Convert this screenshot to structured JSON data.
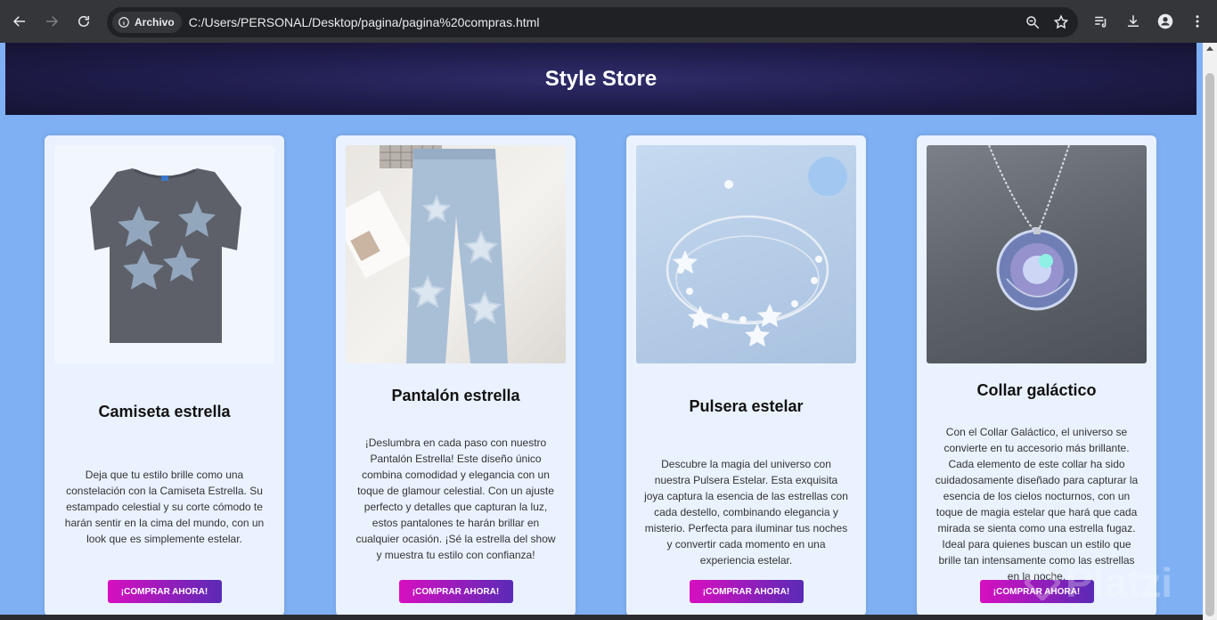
{
  "browser": {
    "chip_label": "Archivo",
    "url": "C:/Users/PERSONAL/Desktop/pagina/pagina%20compras.html"
  },
  "store": {
    "title": "Style Store"
  },
  "products": [
    {
      "title": "Camiseta estrella",
      "description": "Deja que tu estilo brille como una constelación con la Camiseta Estrella. Su estampado celestial y su corte cómodo te harán sentir en la cima del mundo, con un look que es simplemente estelar.",
      "button": "¡COMPRAR AHORA!"
    },
    {
      "title": "Pantalón estrella",
      "description": "¡Deslumbra en cada paso con nuestro Pantalón Estrella! Este diseño único combina comodidad y elegancia con un toque de glamour celestial. Con un ajuste perfecto y detalles que capturan la luz, estos pantalones te harán brillar en cualquier ocasión. ¡Sé la estrella del show y muestra tu estilo con confianza!",
      "button": "¡COMPRAR AHORA!"
    },
    {
      "title": "Pulsera estelar",
      "description": "Descubre la magia del universo con nuestra Pulsera Estelar. Esta exquisita joya captura la esencia de las estrellas con cada destello, combinando elegancia y misterio. Perfecta para iluminar tus noches y convertir cada momento en una experiencia estelar.",
      "button": "¡COMPRAR AHORA!"
    },
    {
      "title": "Collar galáctico",
      "description": "Con el Collar Galáctico, el universo se convierte en tu accesorio más brillante. Cada elemento de este collar ha sido cuidadosamente diseñado para capturar la esencia de los cielos nocturnos, con un toque de magia estelar que hará que cada mirada se sienta como una estrella fugaz. Ideal para quienes buscan un estilo que brille tan intensamente como las estrellas en la noche.",
      "button": "¡COMPRAR AHORA!"
    }
  ],
  "watermark": "Platzi",
  "colors": {
    "page_bg": "#7fb0f3",
    "card_bg": "#eaf2ff",
    "header_bg": "#1e1c4a",
    "button_start": "#d70fc0",
    "button_end": "#5a2ab6"
  },
  "icons": [
    "back-icon",
    "forward-icon",
    "reload-icon",
    "info-icon",
    "zoom-icon",
    "star-icon",
    "reading-list-icon",
    "download-icon",
    "profile-icon",
    "menu-icon"
  ]
}
